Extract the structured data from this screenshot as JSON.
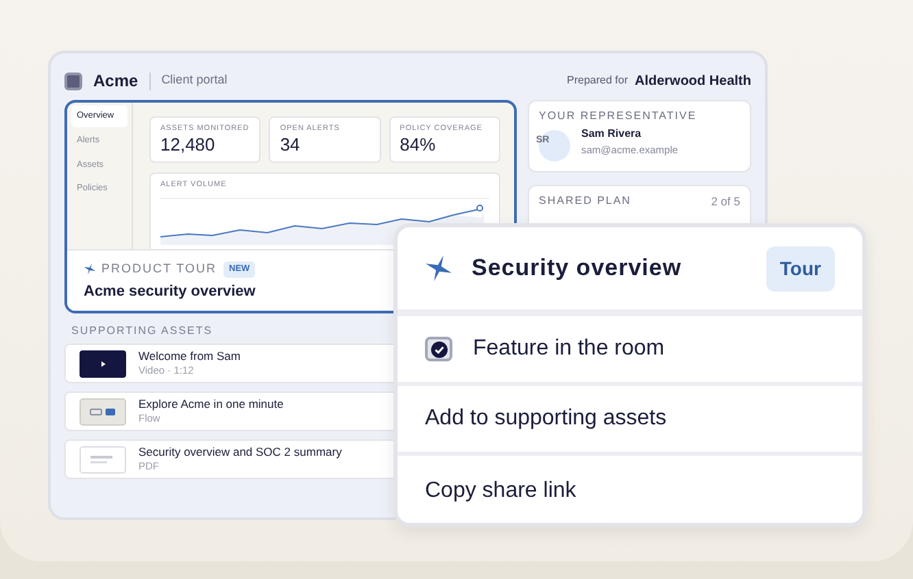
{
  "header": {
    "logo": "Acme",
    "subtitle": "Client portal",
    "prepared_label": "Prepared for",
    "client": "Alderwood Health"
  },
  "preview": {
    "nav": [
      {
        "label": "Overview",
        "selected": true
      },
      {
        "label": "Alerts",
        "selected": false
      },
      {
        "label": "Assets",
        "selected": false
      },
      {
        "label": "Policies",
        "selected": false
      }
    ],
    "stats": [
      {
        "label": "ASSETS MONITORED",
        "value": "12,480"
      },
      {
        "label": "OPEN ALERTS",
        "value": "34"
      },
      {
        "label": "POLICY COVERAGE",
        "value": "84%"
      }
    ],
    "chart_title": "ALERT VOLUME",
    "tour": {
      "eyebrow": "PRODUCT TOUR",
      "badge": "NEW",
      "title": "Acme security overview"
    }
  },
  "representative": {
    "heading": "YOUR REPRESENTATIVE",
    "initials": "SR",
    "name": "Sam Rivera",
    "email": "sam@acme.example"
  },
  "shared_plan": {
    "heading": "SHARED PLAN",
    "progress": "2 of 5"
  },
  "supporting_assets": {
    "heading": "SUPPORTING ASSETS",
    "items": [
      {
        "kind": "video",
        "title": "Welcome from Sam",
        "meta": "Video · 1:12"
      },
      {
        "kind": "flow",
        "title": "Explore Acme in one minute",
        "meta": "Flow"
      },
      {
        "kind": "pdf",
        "title": "Security overview and SOC 2 summary",
        "meta": "PDF"
      }
    ]
  },
  "popover": {
    "title": "Security overview",
    "button": "Tour",
    "items": [
      {
        "kind": "checkbox",
        "label": "Feature in the room",
        "checked": true
      },
      {
        "kind": "action",
        "label": "Add to supporting assets"
      },
      {
        "kind": "action",
        "label": "Copy share link"
      }
    ]
  }
}
